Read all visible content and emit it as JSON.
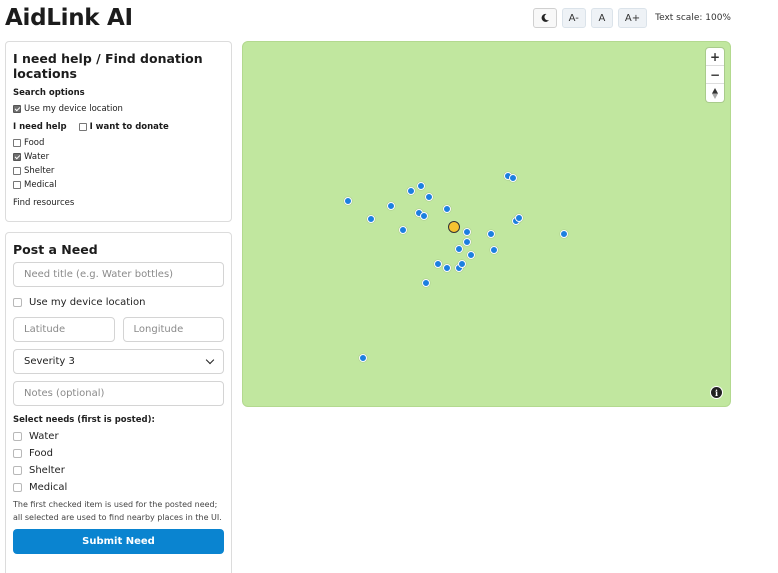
{
  "app": {
    "title": "AidLink AI"
  },
  "accessibility": {
    "dark_toggle_icon": "moon-icon",
    "decrease_label": "A-",
    "reset_label": "A",
    "increase_label": "A+",
    "text_scale": "Text scale: 100%"
  },
  "help_panel": {
    "title": "I need help / Find donation locations",
    "search_options_label": "Search options",
    "use_location": {
      "label": "Use my device location",
      "checked": true
    },
    "need_help_label": "I need help",
    "donate": {
      "label": "I want to donate",
      "checked": false
    },
    "needs": [
      {
        "label": "Food",
        "checked": false
      },
      {
        "label": "Water",
        "checked": true
      },
      {
        "label": "Shelter",
        "checked": false
      },
      {
        "label": "Medical",
        "checked": false
      }
    ],
    "find_label": "Find resources"
  },
  "post_panel": {
    "title": "Post a Need",
    "title_placeholder": "Need title (e.g. Water bottles)",
    "use_location_label": "Use my device location",
    "latitude_placeholder": "Latitude",
    "longitude_placeholder": "Longitude",
    "severity_value": "Severity 3",
    "notes_placeholder": "Notes (optional)",
    "select_needs_label": "Select needs (first is posted):",
    "needs": [
      {
        "label": "Water",
        "checked": false
      },
      {
        "label": "Food",
        "checked": false
      },
      {
        "label": "Shelter",
        "checked": false
      },
      {
        "label": "Medical",
        "checked": false
      }
    ],
    "hint": "The first checked item is used for the posted need; all selected are used to find nearby places in the UI.",
    "submit_label": "Submit Need"
  },
  "map": {
    "background_color": "#c1e79f",
    "marker_color": "#1c7fe0",
    "user_marker_color": "#f5c331",
    "zoom_in": "+",
    "zoom_out": "−",
    "compass_icon": "compass-icon",
    "info_icon": "info-icon"
  }
}
